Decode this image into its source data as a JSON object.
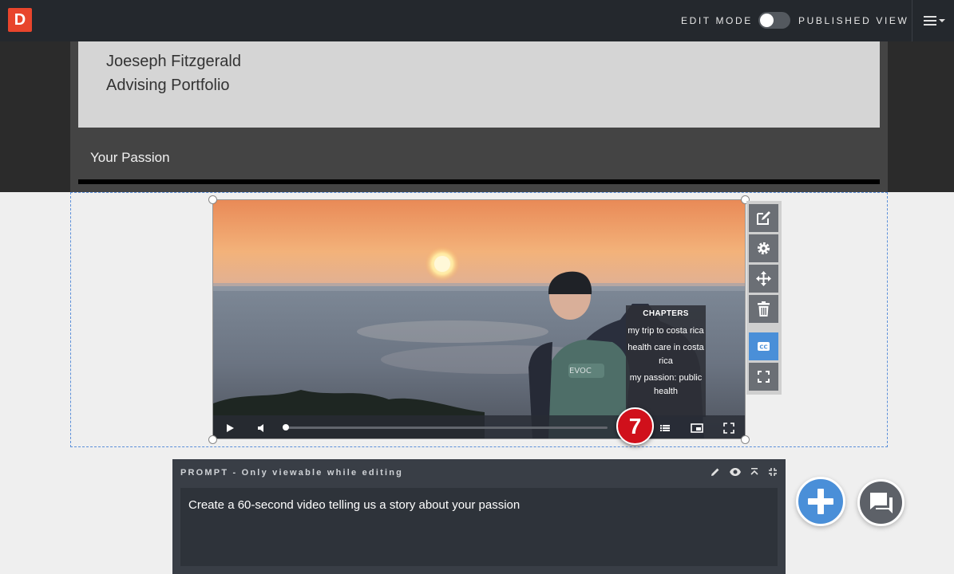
{
  "topbar": {
    "logo_letter": "D",
    "edit_mode_label": "EDIT MODE",
    "published_view_label": "PUBLISHED VIEW",
    "icons": {
      "menu": "hamburger-icon",
      "caret": "caret-down-icon"
    }
  },
  "header": {
    "name_line1": "Joeseph Fitzgerald",
    "name_line2": "Advising Portfolio",
    "section_title": "Your Passion"
  },
  "video": {
    "chapters_title": "CHAPTERS",
    "chapters": [
      "my trip to costa rica",
      "health care in costa rica",
      "my passion: public health"
    ],
    "progress": 0,
    "controls": [
      "play-icon",
      "volume-icon",
      "chapters-list-icon",
      "picture-in-picture-icon",
      "fullscreen-icon"
    ]
  },
  "badge": {
    "number": "7"
  },
  "toolbar": {
    "icons": [
      "edit-icon",
      "gear-icon",
      "move-icon",
      "trash-icon",
      "closed-captions-icon",
      "expand-icon"
    ]
  },
  "prompt": {
    "label": "PROMPT - Only viewable while editing",
    "text": "Create a 60-second video telling us a story about your passion",
    "icons": [
      "pencil-icon",
      "eye-icon",
      "collapse-up-icon",
      "compress-icon"
    ]
  },
  "actions": {
    "icons": [
      "plus-icon",
      "chat-icon"
    ]
  },
  "colors": {
    "topbar": "#24282d",
    "logo": "#e8452c",
    "accent_blue": "#4a8fd8",
    "badge_red": "#d0101b",
    "prompt_panel": "#393e46"
  }
}
